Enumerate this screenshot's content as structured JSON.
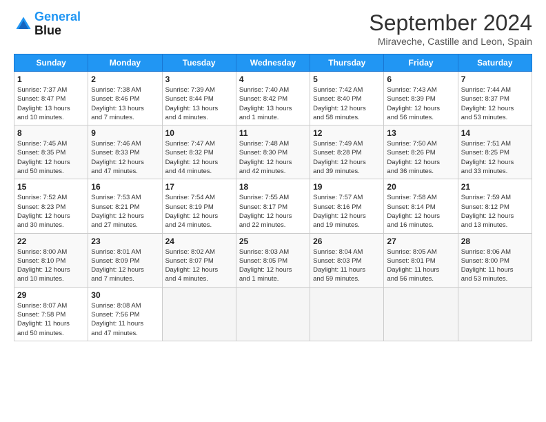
{
  "header": {
    "logo_line1": "General",
    "logo_line2": "Blue",
    "month_title": "September 2024",
    "location": "Miraveche, Castille and Leon, Spain"
  },
  "days_of_week": [
    "Sunday",
    "Monday",
    "Tuesday",
    "Wednesday",
    "Thursday",
    "Friday",
    "Saturday"
  ],
  "weeks": [
    [
      {
        "day": "1",
        "info": "Sunrise: 7:37 AM\nSunset: 8:47 PM\nDaylight: 13 hours\nand 10 minutes."
      },
      {
        "day": "2",
        "info": "Sunrise: 7:38 AM\nSunset: 8:46 PM\nDaylight: 13 hours\nand 7 minutes."
      },
      {
        "day": "3",
        "info": "Sunrise: 7:39 AM\nSunset: 8:44 PM\nDaylight: 13 hours\nand 4 minutes."
      },
      {
        "day": "4",
        "info": "Sunrise: 7:40 AM\nSunset: 8:42 PM\nDaylight: 13 hours\nand 1 minute."
      },
      {
        "day": "5",
        "info": "Sunrise: 7:42 AM\nSunset: 8:40 PM\nDaylight: 12 hours\nand 58 minutes."
      },
      {
        "day": "6",
        "info": "Sunrise: 7:43 AM\nSunset: 8:39 PM\nDaylight: 12 hours\nand 56 minutes."
      },
      {
        "day": "7",
        "info": "Sunrise: 7:44 AM\nSunset: 8:37 PM\nDaylight: 12 hours\nand 53 minutes."
      }
    ],
    [
      {
        "day": "8",
        "info": "Sunrise: 7:45 AM\nSunset: 8:35 PM\nDaylight: 12 hours\nand 50 minutes."
      },
      {
        "day": "9",
        "info": "Sunrise: 7:46 AM\nSunset: 8:33 PM\nDaylight: 12 hours\nand 47 minutes."
      },
      {
        "day": "10",
        "info": "Sunrise: 7:47 AM\nSunset: 8:32 PM\nDaylight: 12 hours\nand 44 minutes."
      },
      {
        "day": "11",
        "info": "Sunrise: 7:48 AM\nSunset: 8:30 PM\nDaylight: 12 hours\nand 42 minutes."
      },
      {
        "day": "12",
        "info": "Sunrise: 7:49 AM\nSunset: 8:28 PM\nDaylight: 12 hours\nand 39 minutes."
      },
      {
        "day": "13",
        "info": "Sunrise: 7:50 AM\nSunset: 8:26 PM\nDaylight: 12 hours\nand 36 minutes."
      },
      {
        "day": "14",
        "info": "Sunrise: 7:51 AM\nSunset: 8:25 PM\nDaylight: 12 hours\nand 33 minutes."
      }
    ],
    [
      {
        "day": "15",
        "info": "Sunrise: 7:52 AM\nSunset: 8:23 PM\nDaylight: 12 hours\nand 30 minutes."
      },
      {
        "day": "16",
        "info": "Sunrise: 7:53 AM\nSunset: 8:21 PM\nDaylight: 12 hours\nand 27 minutes."
      },
      {
        "day": "17",
        "info": "Sunrise: 7:54 AM\nSunset: 8:19 PM\nDaylight: 12 hours\nand 24 minutes."
      },
      {
        "day": "18",
        "info": "Sunrise: 7:55 AM\nSunset: 8:17 PM\nDaylight: 12 hours\nand 22 minutes."
      },
      {
        "day": "19",
        "info": "Sunrise: 7:57 AM\nSunset: 8:16 PM\nDaylight: 12 hours\nand 19 minutes."
      },
      {
        "day": "20",
        "info": "Sunrise: 7:58 AM\nSunset: 8:14 PM\nDaylight: 12 hours\nand 16 minutes."
      },
      {
        "day": "21",
        "info": "Sunrise: 7:59 AM\nSunset: 8:12 PM\nDaylight: 12 hours\nand 13 minutes."
      }
    ],
    [
      {
        "day": "22",
        "info": "Sunrise: 8:00 AM\nSunset: 8:10 PM\nDaylight: 12 hours\nand 10 minutes."
      },
      {
        "day": "23",
        "info": "Sunrise: 8:01 AM\nSunset: 8:09 PM\nDaylight: 12 hours\nand 7 minutes."
      },
      {
        "day": "24",
        "info": "Sunrise: 8:02 AM\nSunset: 8:07 PM\nDaylight: 12 hours\nand 4 minutes."
      },
      {
        "day": "25",
        "info": "Sunrise: 8:03 AM\nSunset: 8:05 PM\nDaylight: 12 hours\nand 1 minute."
      },
      {
        "day": "26",
        "info": "Sunrise: 8:04 AM\nSunset: 8:03 PM\nDaylight: 11 hours\nand 59 minutes."
      },
      {
        "day": "27",
        "info": "Sunrise: 8:05 AM\nSunset: 8:01 PM\nDaylight: 11 hours\nand 56 minutes."
      },
      {
        "day": "28",
        "info": "Sunrise: 8:06 AM\nSunset: 8:00 PM\nDaylight: 11 hours\nand 53 minutes."
      }
    ],
    [
      {
        "day": "29",
        "info": "Sunrise: 8:07 AM\nSunset: 7:58 PM\nDaylight: 11 hours\nand 50 minutes."
      },
      {
        "day": "30",
        "info": "Sunrise: 8:08 AM\nSunset: 7:56 PM\nDaylight: 11 hours\nand 47 minutes."
      },
      {
        "day": "",
        "info": ""
      },
      {
        "day": "",
        "info": ""
      },
      {
        "day": "",
        "info": ""
      },
      {
        "day": "",
        "info": ""
      },
      {
        "day": "",
        "info": ""
      }
    ]
  ]
}
